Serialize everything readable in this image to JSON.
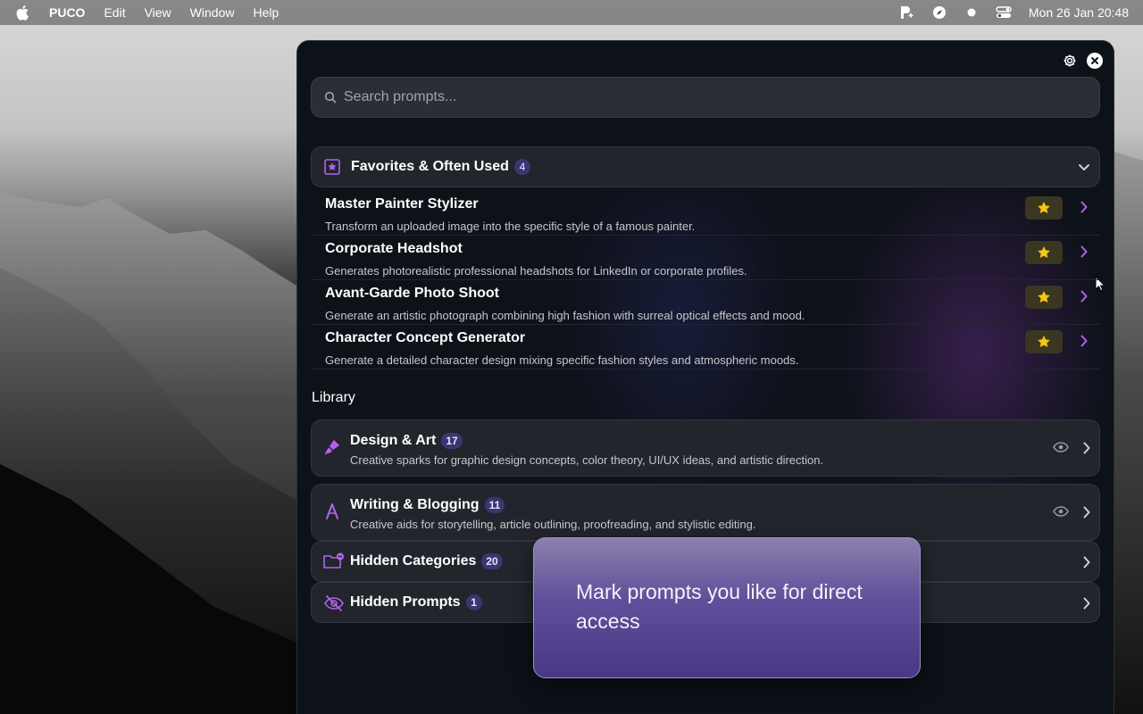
{
  "menubar": {
    "app_name": "PUCO",
    "menus": [
      "Edit",
      "View",
      "Window",
      "Help"
    ],
    "clock": "Mon 26 Jan  20:48"
  },
  "search": {
    "placeholder": "Search prompts..."
  },
  "favorites": {
    "title": "Favorites & Often Used",
    "count": "4",
    "items": [
      {
        "title": "Master Painter Stylizer",
        "description": "Transform an uploaded image into the specific style of a famous painter."
      },
      {
        "title": "Corporate Headshot",
        "description": "Generates photorealistic professional headshots for LinkedIn or corporate profiles."
      },
      {
        "title": "Avant-Garde Photo Shoot",
        "description": "Generate an artistic photograph combining high fashion with surreal optical effects and mood."
      },
      {
        "title": "Character Concept Generator",
        "description": "Generate a detailed character design mixing specific fashion styles and atmospheric moods."
      }
    ]
  },
  "library": {
    "label": "Library",
    "categories": [
      {
        "title": "Design & Art",
        "count": "17",
        "description": "Creative sparks for graphic design concepts, color theory, UI/UX ideas, and artistic direction."
      },
      {
        "title": "Writing & Blogging",
        "count": "11",
        "description": "Creative aids for storytelling, article outlining, proofreading, and stylistic editing."
      }
    ],
    "hidden_categories": {
      "title": "Hidden Categories",
      "count": "20"
    },
    "hidden_prompts": {
      "title": "Hidden Prompts",
      "count": "1"
    }
  },
  "tooltip": {
    "text": "Mark prompts you like for direct access"
  },
  "colors": {
    "accent": "#b063f0",
    "star": "#f5c518",
    "badge": "#3b3671",
    "window_bg": "#0d1118"
  }
}
